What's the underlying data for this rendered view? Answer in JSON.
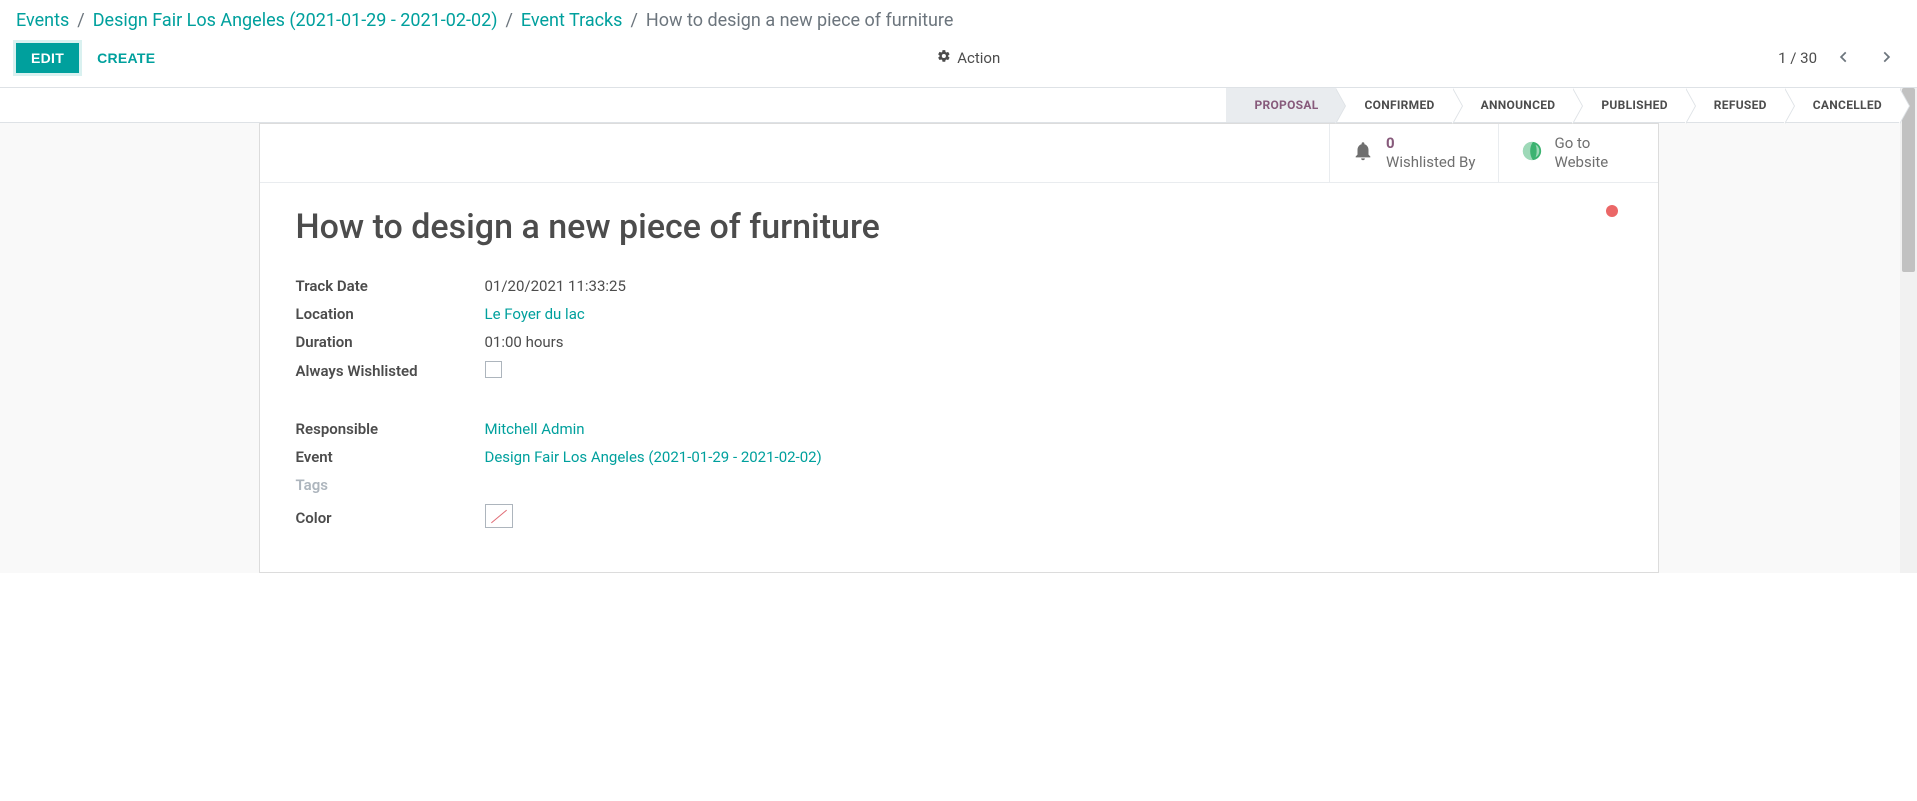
{
  "breadcrumb": {
    "items": [
      {
        "label": "Events"
      },
      {
        "label": "Design Fair Los Angeles (2021-01-29 - 2021-02-02)"
      },
      {
        "label": "Event Tracks"
      }
    ],
    "current": "How to design a new piece of furniture"
  },
  "toolbar": {
    "edit_label": "Edit",
    "create_label": "Create",
    "action_label": "Action"
  },
  "pager": {
    "value": "1 / 30"
  },
  "statusbar": {
    "steps": [
      {
        "label": "Proposal",
        "active": true
      },
      {
        "label": "Confirmed",
        "active": false
      },
      {
        "label": "Announced",
        "active": false
      },
      {
        "label": "Published",
        "active": false
      },
      {
        "label": "Refused",
        "active": false
      },
      {
        "label": "Cancelled",
        "active": false
      }
    ]
  },
  "stat_buttons": {
    "wishlist": {
      "count": "0",
      "label": "Wishlisted By"
    },
    "website": {
      "line1": "Go to",
      "line2": "Website"
    }
  },
  "record": {
    "title": "How to design a new piece of furniture",
    "fields": {
      "track_date": {
        "label": "Track Date",
        "value": "01/20/2021 11:33:25"
      },
      "location": {
        "label": "Location",
        "value": "Le Foyer du lac"
      },
      "duration": {
        "label": "Duration",
        "value": "01:00",
        "unit": "hours"
      },
      "always_wishlisted": {
        "label": "Always Wishlisted",
        "checked": false
      },
      "responsible": {
        "label": "Responsible",
        "value": "Mitchell Admin"
      },
      "event": {
        "label": "Event",
        "value": "Design Fair Los Angeles (2021-01-29 - 2021-02-02)"
      },
      "tags": {
        "label": "Tags",
        "value": ""
      },
      "color": {
        "label": "Color"
      }
    }
  },
  "colors": {
    "primary": "#00A09D",
    "kanban_state": "#eb6767",
    "wishlist_count": "#875A7B"
  }
}
